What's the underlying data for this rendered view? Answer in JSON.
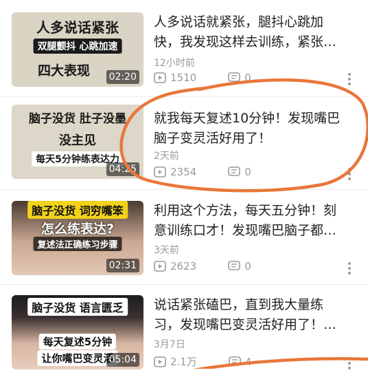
{
  "videos": [
    {
      "thumb": {
        "line1": "人多说话紧张",
        "line2": "双腿颤抖 心跳加速",
        "line3": "四大表现"
      },
      "duration": "02:20",
      "title_line1": "人多说话就紧张，腿抖心跳加",
      "title_line2": "快，我发现这样去训练，紧张…",
      "time": "12小时前",
      "plays": "1510",
      "comments": "0"
    },
    {
      "thumb": {
        "line1": "脑子没货 肚子没墨",
        "line2": "没主见",
        "line3": "每天5分钟练表达力"
      },
      "duration": "04:25",
      "title_line1": "就我每天复述10分钟！发现嘴巴",
      "title_line2": "脑子变灵活好用了！",
      "time": "2天前",
      "plays": "2354",
      "comments": "0"
    },
    {
      "thumb": {
        "line1": "脑子没货 词穷嘴笨",
        "line2": "怎么练表达?",
        "line3": "复述法正确练习步骤"
      },
      "duration": "02:31",
      "title_line1": "利用这个方法，每天五分钟！刻",
      "title_line2": "意训练口才！发现嘴巴脑子都…",
      "time": "3天前",
      "plays": "2623",
      "comments": "0"
    },
    {
      "thumb": {
        "line1": "脑子没货 语言匮乏",
        "line2": "每天复述5分钟",
        "line3": "让你嘴巴变灵活"
      },
      "duration": "05:04",
      "title_line1": "说话紧张磕巴，直到我大量练",
      "title_line2": "习，发现嘴巴变灵活好用了！…",
      "time": "3月7日",
      "plays": "2.1万",
      "comments": "4"
    }
  ],
  "colors": {
    "annotation": "#e8773a",
    "meta_text": "#999999",
    "title_text": "#222222"
  }
}
